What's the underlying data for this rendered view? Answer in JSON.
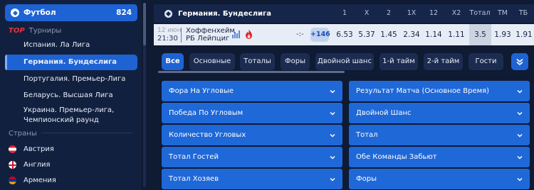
{
  "sidebar": {
    "sport": {
      "name": "Футбол",
      "count": "824"
    },
    "tournaments_badge": "TOP",
    "tournaments_title": "Турниры",
    "leagues": [
      {
        "label": "Испания. Ла Лига"
      },
      {
        "label": "Германия. Бундеслига"
      },
      {
        "label": "Португалия. Премьер-Лига"
      },
      {
        "label": "Беларусь. Высшая Лига"
      },
      {
        "label": "Украина. Премьер-лига, Чемпионский раунд"
      }
    ],
    "countries_title": "Страны",
    "countries": [
      {
        "label": "Австрия"
      },
      {
        "label": "Англия"
      },
      {
        "label": "Армения"
      }
    ]
  },
  "league_bar": {
    "title": "Германия. Бундеслига",
    "columns": [
      "1",
      "X",
      "2",
      "1X",
      "12",
      "X2",
      "Тотал",
      "ТМ",
      "ТБ"
    ]
  },
  "event": {
    "date": "12 июн",
    "time": "21:30",
    "home": "Хоффенхейм",
    "away": "РБ Лейпциг",
    "score": "-:-",
    "more": "+146",
    "odds": [
      "6.53",
      "5.37",
      "1.45",
      "2.34",
      "1.14",
      "1.11",
      "3.5",
      "1.93",
      "1.91"
    ]
  },
  "filters": [
    "Все",
    "Основные",
    "Тоталы",
    "Форы",
    "Двойной шанс",
    "1-й тайм",
    "2-й тайм",
    "Гости"
  ],
  "markets_left": [
    "Фора На Угловые",
    "Победа По Угловым",
    "Количество Угловых",
    "Тотал Гостей",
    "Тотал Хозяев"
  ],
  "markets_right": [
    "Результат Матча (Основное Время)",
    "Двойной Шанс",
    "Тотал",
    "Обе Команды Забьют",
    "Форы"
  ],
  "colors": {
    "accent": "#1e63d3",
    "panel": "#1f68d8",
    "background": "#0f1a33",
    "top_badge": "#e8333b"
  }
}
